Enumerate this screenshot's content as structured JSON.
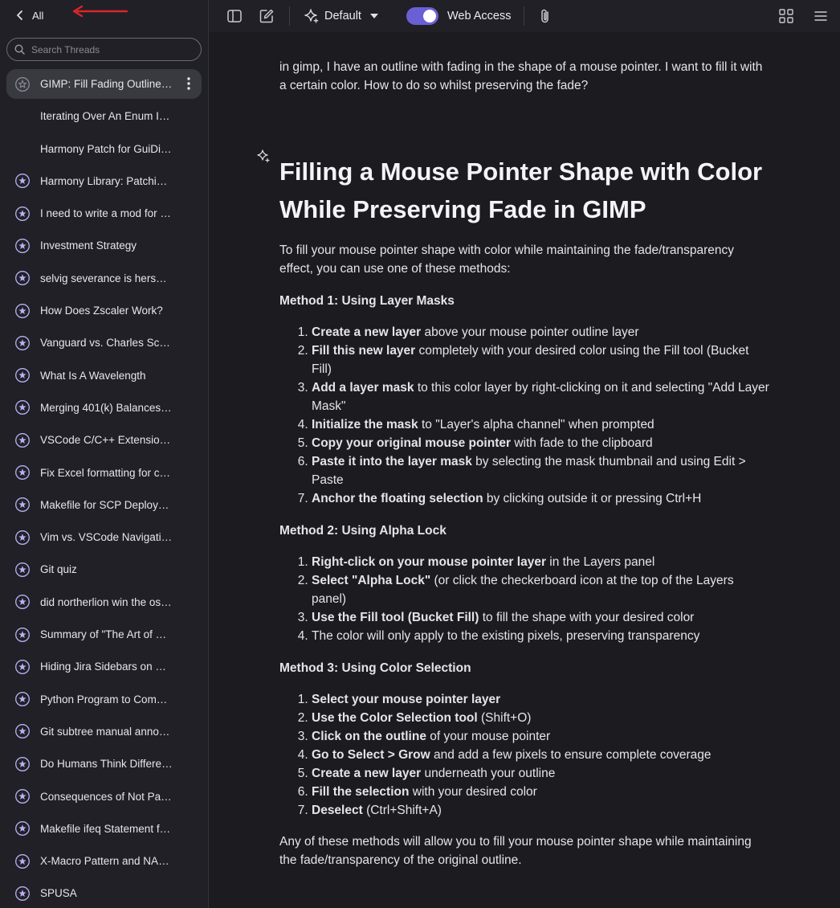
{
  "sidebar": {
    "back_label": "All",
    "search_placeholder": "Search Threads",
    "threads": [
      {
        "label": "GIMP: Fill Fading Outline…",
        "icon": "star-outline-icon",
        "active": true
      },
      {
        "label": "Iterating Over An Enum I…",
        "icon": "none"
      },
      {
        "label": "Harmony Patch for GuiDi…",
        "icon": "none"
      },
      {
        "label": "Harmony Library: Patchi…",
        "icon": "star-icon"
      },
      {
        "label": "I need to write a mod for …",
        "icon": "star-icon"
      },
      {
        "label": "Investment Strategy",
        "icon": "star-icon"
      },
      {
        "label": "selvig severance is hers…",
        "icon": "star-icon"
      },
      {
        "label": "How Does Zscaler Work?",
        "icon": "star-icon"
      },
      {
        "label": "Vanguard vs. Charles Sc…",
        "icon": "star-icon"
      },
      {
        "label": "What Is A Wavelength",
        "icon": "star-icon"
      },
      {
        "label": "Merging 401(k) Balances…",
        "icon": "star-icon"
      },
      {
        "label": "VSCode C/C++ Extensio…",
        "icon": "star-icon"
      },
      {
        "label": "Fix Excel formatting for c…",
        "icon": "star-icon"
      },
      {
        "label": "Makefile for SCP Deploy…",
        "icon": "star-icon"
      },
      {
        "label": "Vim vs. VSCode Navigati…",
        "icon": "star-icon"
      },
      {
        "label": "Git quiz",
        "icon": "star-icon"
      },
      {
        "label": "did northerlion win the os…",
        "icon": "star-icon"
      },
      {
        "label": "Summary of \"The Art of …",
        "icon": "star-icon"
      },
      {
        "label": "Hiding Jira Sidebars on …",
        "icon": "star-icon"
      },
      {
        "label": "Python Program to Com…",
        "icon": "star-icon"
      },
      {
        "label": "Git subtree manual anno…",
        "icon": "star-icon"
      },
      {
        "label": "Do Humans Think Differe…",
        "icon": "star-icon"
      },
      {
        "label": "Consequences of Not Pa…",
        "icon": "star-icon"
      },
      {
        "label": "Makefile ifeq Statement f…",
        "icon": "star-icon"
      },
      {
        "label": "X-Macro Pattern and NA…",
        "icon": "star-icon"
      },
      {
        "label": "SPUSA",
        "icon": "star-icon"
      }
    ]
  },
  "topbar": {
    "model_label": "Default",
    "web_access_label": "Web Access",
    "web_access_enabled": true
  },
  "conversation": {
    "user_message": "in gimp, I have an outline with fading in the shape of a mouse pointer. I want to fill it with a certain color. How to do so whilst preserving the fade?",
    "title": "Filling a Mouse Pointer Shape with Color While Preserving Fade in GIMP",
    "intro": "To fill your mouse pointer shape with color while maintaining the fade/transparency effect, you can use one of these methods:",
    "methods": [
      {
        "heading": "Method 1: Using Layer Masks",
        "steps": [
          {
            "bold": "Create a new layer",
            "rest": " above your mouse pointer outline layer"
          },
          {
            "bold": "Fill this new layer",
            "rest": " completely with your desired color using the Fill tool (Bucket Fill)"
          },
          {
            "bold": "Add a layer mask",
            "rest": " to this color layer by right-clicking on it and selecting \"Add Layer Mask\""
          },
          {
            "bold": "Initialize the mask",
            "rest": " to \"Layer's alpha channel\" when prompted"
          },
          {
            "bold": "Copy your original mouse pointer",
            "rest": " with fade to the clipboard"
          },
          {
            "bold": "Paste it into the layer mask",
            "rest": " by selecting the mask thumbnail and using Edit > Paste"
          },
          {
            "bold": "Anchor the floating selection",
            "rest": " by clicking outside it or pressing Ctrl+H"
          }
        ]
      },
      {
        "heading": "Method 2: Using Alpha Lock",
        "steps": [
          {
            "bold": "Right-click on your mouse pointer layer",
            "rest": " in the Layers panel"
          },
          {
            "bold": "Select \"Alpha Lock\"",
            "rest": " (or click the checkerboard icon at the top of the Layers panel)"
          },
          {
            "bold": "Use the Fill tool (Bucket Fill)",
            "rest": " to fill the shape with your desired color"
          },
          {
            "bold": "",
            "rest": "The color will only apply to the existing pixels, preserving transparency"
          }
        ]
      },
      {
        "heading": "Method 3: Using Color Selection",
        "steps": [
          {
            "bold": "Select your mouse pointer layer",
            "rest": ""
          },
          {
            "bold": "Use the Color Selection tool",
            "rest": " (Shift+O)"
          },
          {
            "bold": "Click on the outline",
            "rest": " of your mouse pointer"
          },
          {
            "bold": "Go to Select > Grow",
            "rest": " and add a few pixels to ensure complete coverage"
          },
          {
            "bold": "Create a new layer",
            "rest": " underneath your outline"
          },
          {
            "bold": "Fill the selection",
            "rest": " with your desired color"
          },
          {
            "bold": "Deselect",
            "rest": " (Ctrl+Shift+A)"
          }
        ]
      }
    ],
    "outro": "Any of these methods will allow you to fill your mouse pointer shape while maintaining the fade/transparency of the original outline."
  },
  "colors": {
    "accent": "#6b5fd6",
    "star_icon": "#b9b0f5",
    "annotation_arrow": "#d9262a"
  }
}
